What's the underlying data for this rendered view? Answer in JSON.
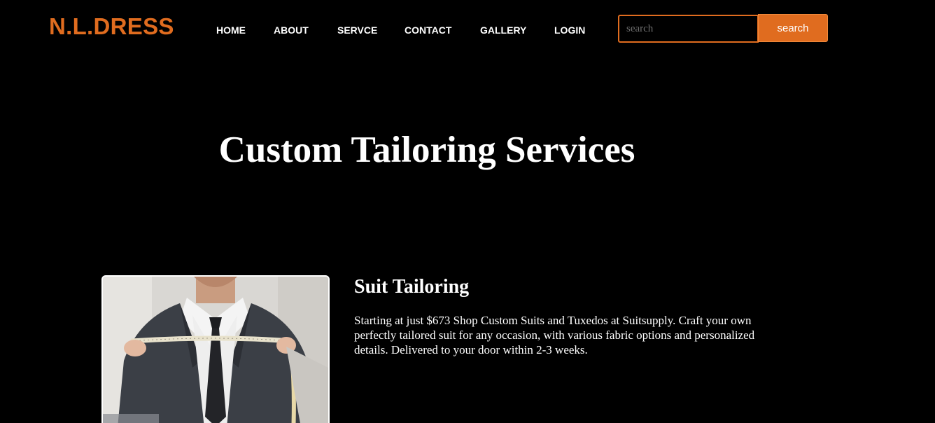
{
  "brand": {
    "logo": "N.L.DRESS",
    "accent_color": "#e06c1f",
    "background_color": "#000000"
  },
  "nav": {
    "items": [
      {
        "label": "HOME"
      },
      {
        "label": "ABOUT"
      },
      {
        "label": "SERVCE"
      },
      {
        "label": "CONTACT"
      },
      {
        "label": "GALLERY"
      },
      {
        "label": "LOGIN"
      }
    ]
  },
  "search": {
    "placeholder": "search",
    "value": "",
    "button_label": "search"
  },
  "hero": {
    "title": "Custom Tailoring Services"
  },
  "services": [
    {
      "title": "Suit Tailoring",
      "description": "Starting at just $673 Shop Custom Suits and Tuxedos at Suitsupply. Craft your own perfectly tailored suit for any occasion, with various fabric options and personalized details. Delivered to your door within 2-3 weeks.",
      "image_icon": "tailor-measuring-suit-photo"
    }
  ]
}
